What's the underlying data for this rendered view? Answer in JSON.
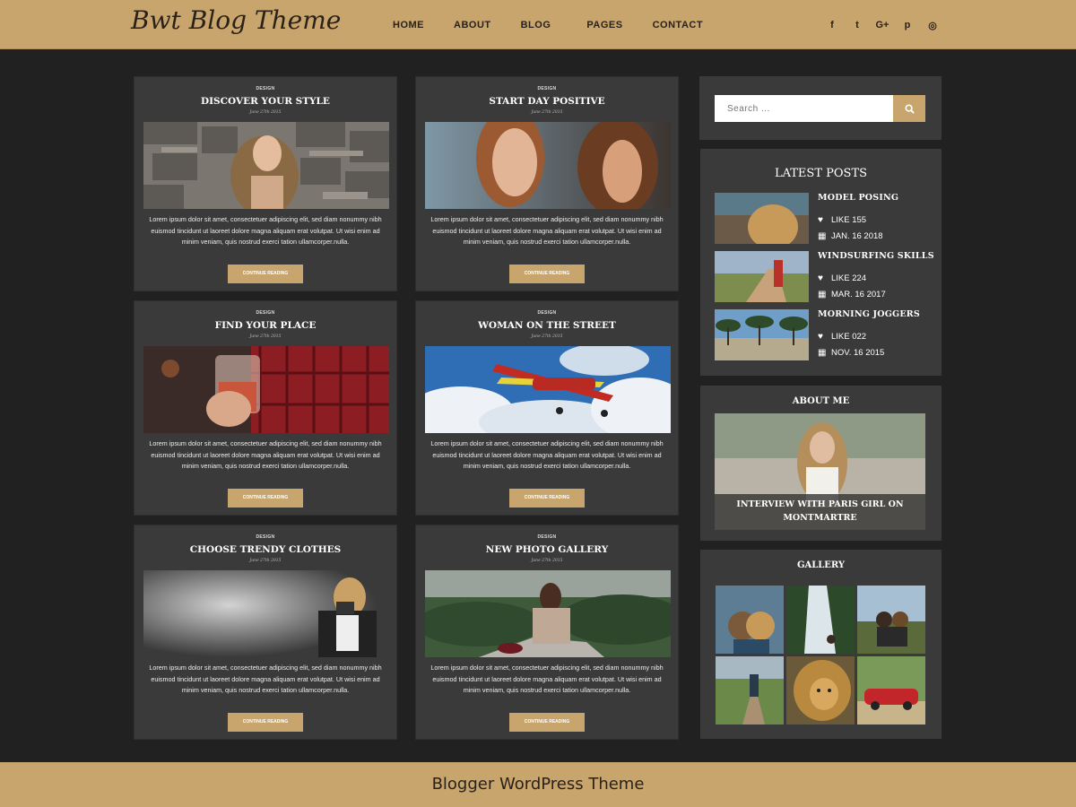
{
  "header": {
    "logo": "Bwt Blog Theme",
    "nav": [
      "HOME",
      "ABOUT",
      "BLOG",
      "PAGES",
      "CONTACT"
    ],
    "social": [
      {
        "icon": "facebook-icon",
        "glyph": "f"
      },
      {
        "icon": "twitter-icon",
        "glyph": "t"
      },
      {
        "icon": "google-plus-icon",
        "glyph": "G+"
      },
      {
        "icon": "pinterest-icon",
        "glyph": "p"
      },
      {
        "icon": "instagram-icon",
        "glyph": "◎"
      }
    ]
  },
  "posts": [
    {
      "category": "DESIGN",
      "title": "DISCOVER YOUR STYLE",
      "date": "June 27th 2015",
      "excerpt": "Lorem ipsum dolor sit amet, consectetuer adipiscing elit, sed diam nonummy nibh euismod tincidunt ut laoreet dolore magna aliquam erat volutpat. Ut wisi enim ad minim veniam, quis nostrud exerci tation ullamcorper.nulla.",
      "button": "CONTINUE READING"
    },
    {
      "category": "DESIGN",
      "title": "START DAY POSITIVE",
      "date": "June 27th 2015",
      "excerpt": "Lorem ipsum dolor sit amet, consectetuer adipiscing elit, sed diam nonummy nibh euismod tincidunt ut laoreet dolore magna aliquam erat volutpat. Ut wisi enim ad minim veniam, quis nostrud exerci tation ullamcorper.nulla.",
      "button": "CONTINUE READING"
    },
    {
      "category": "DESIGN",
      "title": "FIND YOUR PLACE",
      "date": "June 27th 2015",
      "excerpt": "Lorem ipsum dolor sit amet, consectetuer adipiscing elit, sed diam nonummy nibh euismod tincidunt ut laoreet dolore magna aliquam erat volutpat. Ut wisi enim ad minim veniam, quis nostrud exerci tation ullamcorper.nulla.",
      "button": "CONTINUE READING"
    },
    {
      "category": "DESIGN",
      "title": "WOMAN ON THE STREET",
      "date": "June 27th 2015",
      "excerpt": "Lorem ipsum dolor sit amet, consectetuer adipiscing elit, sed diam nonummy nibh euismod tincidunt ut laoreet dolore magna aliquam erat volutpat. Ut wisi enim ad minim veniam, quis nostrud exerci tation ullamcorper.nulla.",
      "button": "CONTINUE READING"
    },
    {
      "category": "DESIGN",
      "title": "CHOOSE TRENDY CLOTHES",
      "date": "June 27th 2015",
      "excerpt": "Lorem ipsum dolor sit amet, consectetuer adipiscing elit, sed diam nonummy nibh euismod tincidunt ut laoreet dolore magna aliquam erat volutpat. Ut wisi enim ad minim veniam, quis nostrud exerci tation ullamcorper.nulla.",
      "button": "CONTINUE READING"
    },
    {
      "category": "DESIGN",
      "title": "NEW PHOTO GALLERY",
      "date": "June 27th 2015",
      "excerpt": "Lorem ipsum dolor sit amet, consectetuer adipiscing elit, sed diam nonummy nibh euismod tincidunt ut laoreet dolore magna aliquam erat volutpat. Ut wisi enim ad minim veniam, quis nostrud exerci tation ullamcorper.nulla.",
      "button": "CONTINUE READING"
    }
  ],
  "sidebar": {
    "search": {
      "placeholder": "Search ..."
    },
    "latest": {
      "title": "LATEST POSTS",
      "items": [
        {
          "title": "MODEL POSING",
          "likes": "LIKE 155",
          "date": "JAN. 16 2018"
        },
        {
          "title": "WINDSURFING SKILLS",
          "likes": "LIKE 224",
          "date": "MAR. 16 2017"
        },
        {
          "title": "MORNING JOGGERS",
          "likes": "LIKE 022",
          "date": "NOV. 16 2015"
        }
      ]
    },
    "about": {
      "title": "ABOUT ME",
      "caption": "INTERVIEW WITH PARIS GIRL ON MONTMARTRE"
    },
    "gallery": {
      "title": "GALLERY"
    }
  },
  "footer": {
    "text": "Blogger WordPress Theme"
  },
  "colors": {
    "accent": "#c8a56d",
    "background": "#212121",
    "panel": "#3a3a3a",
    "dark_text": "#2a2118"
  }
}
